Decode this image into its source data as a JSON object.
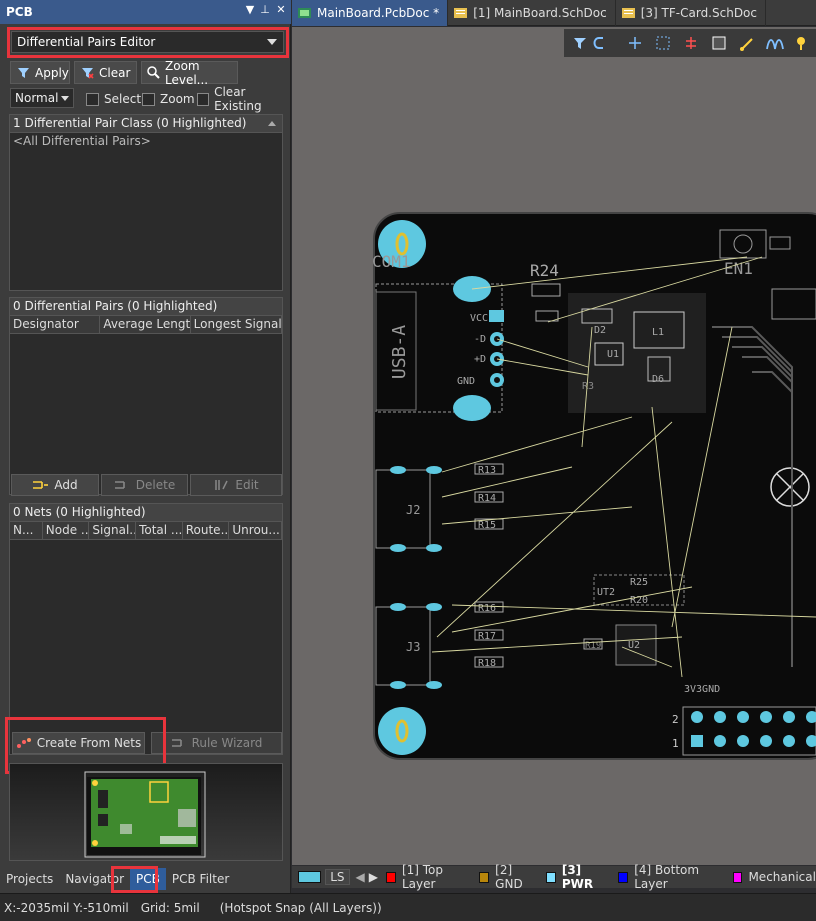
{
  "panel": {
    "title": "PCB",
    "mode": "Differential Pairs Editor",
    "apply": "Apply",
    "clear": "Clear",
    "zoom_level": "Zoom Level...",
    "view_mode": "Normal",
    "select": "Select",
    "zoom": "Zoom",
    "clear_existing": "Clear Existing",
    "class_header": "1 Differential Pair Class (0 Highlighted)",
    "class_item": "<All Differential Pairs>",
    "pairs_header": "0 Differential Pairs (0 Highlighted)",
    "pairs_cols": [
      "Designator",
      "Average Lengt...",
      "Longest Signal..."
    ],
    "add": "Add",
    "delete": "Delete",
    "edit": "Edit",
    "nets_header": "0 Nets (0 Highlighted)",
    "nets_cols": [
      "N...",
      "Node ...",
      "Signal...",
      "Total ...",
      "Route...",
      "Unrou..."
    ],
    "create_from_nets": "Create From Nets",
    "rule_wizard": "Rule Wizard",
    "bottom_tabs": [
      "Projects",
      "Navigator",
      "PCB",
      "PCB Filter"
    ]
  },
  "doc_tabs": [
    "MainBoard.PcbDoc *",
    "[1] MainBoard.SchDoc",
    "[3] TF-Card.SchDoc"
  ],
  "pcb": {
    "labels": {
      "com1": "COM1",
      "usba": "USB-A",
      "vcc": "VCC",
      "dminus": "-D",
      "dplus": "+D",
      "gnd": "GND",
      "r24": "R24",
      "en1": "EN1",
      "j2": "J2",
      "j3": "J3",
      "r13": "R13",
      "r14": "R14",
      "r15": "R15",
      "r16": "R16",
      "r17": "R17",
      "r18": "R18",
      "u1": "U1",
      "l1": "L1",
      "d2": "D2",
      "d6": "D6",
      "r3": "R3",
      "ut2": "UT2",
      "r25": "R25",
      "r20": "R20",
      "r19": "R19",
      "u2": "U2",
      "gnd_hdr": "3V3GND",
      "row2": "2",
      "row1": "1"
    }
  },
  "layers": {
    "ls": "LS",
    "items": [
      {
        "name": "[1] Top Layer",
        "color": "#ff0000"
      },
      {
        "name": "[2] GND",
        "color": "#b8860b"
      },
      {
        "name": "[3] PWR",
        "color": "#7fdfff"
      },
      {
        "name": "[4] Bottom Layer",
        "color": "#0000ff"
      },
      {
        "name": "Mechanical",
        "color": "#ff00ff"
      }
    ]
  },
  "status": {
    "coords": "X:-2035mil Y:-510mil",
    "grid": "Grid: 5mil",
    "snap": "(Hotspot Snap (All Layers))"
  }
}
